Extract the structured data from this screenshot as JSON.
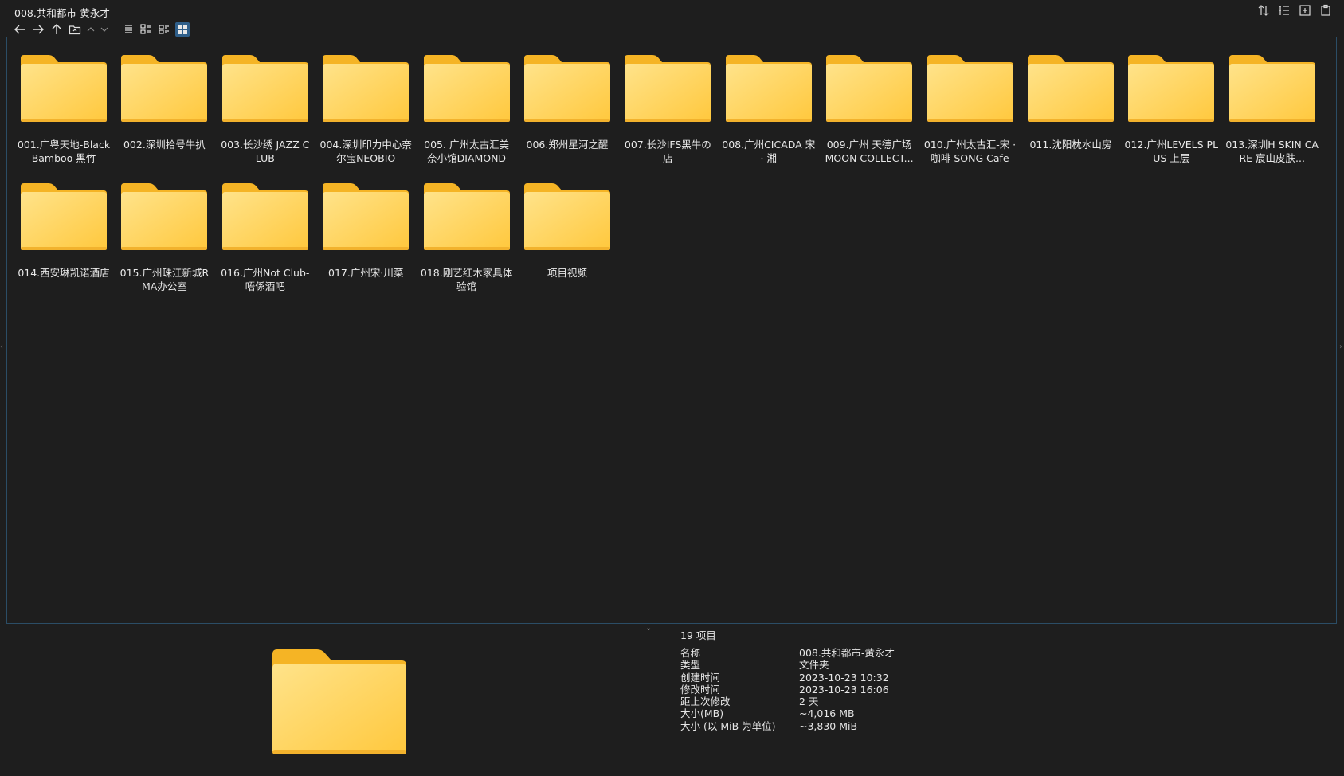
{
  "window": {
    "title": "008.共和都市-黄永才"
  },
  "colors": {
    "background": "#1e1e1e",
    "folder_body": "#ffd25c",
    "folder_tab": "#f5b82e",
    "accent": "#2f5f8a",
    "border": "#2b4d66"
  },
  "toolbar": {
    "icons": [
      "back-arrow-icon",
      "forward-arrow-icon",
      "up-arrow-icon",
      "folder-nav-icon",
      "chevron-up-icon",
      "chevron-down-icon",
      "list-view-icon",
      "details-view-icon",
      "tiles-view-icon",
      "thumbnail-view-icon"
    ],
    "active_view": "thumbnail-view-icon"
  },
  "top_tools": {
    "icons": [
      "sort-icon",
      "tree-list-icon",
      "new-pane-icon",
      "clipboard-icon"
    ]
  },
  "folders": [
    {
      "name": "001.广粤天地-Black Bamboo 黑竹"
    },
    {
      "name": "002.深圳拾号牛扒"
    },
    {
      "name": "003.长沙绣 JAZZ CLUB"
    },
    {
      "name": "004.深圳印力中心奈尔宝NEOBIO"
    },
    {
      "name": "005. 广州太古汇美奈小馆DIAMOND"
    },
    {
      "name": "006.郑州星河之醒"
    },
    {
      "name": "007.长沙IFS黑牛の店"
    },
    {
      "name": "008.广州CICADA 宋 · 湘"
    },
    {
      "name": "009.广州 天德广场 MOON COLLECT..."
    },
    {
      "name": "010.广州太古汇-宋 · 咖啡 SONG Cafe"
    },
    {
      "name": "011.沈阳枕水山房"
    },
    {
      "name": "012.广州LEVELS PLUS 上层"
    },
    {
      "name": "013.深圳H SKIN CARE 宸山皮肤..."
    },
    {
      "name": "014.西安琳凯诺酒店"
    },
    {
      "name": "015.广州珠江新城RMA办公室"
    },
    {
      "name": "016.广州Not Club-唔係酒吧"
    },
    {
      "name": "017.广州宋·川菜"
    },
    {
      "name": "018.刚艺红木家具体验馆"
    },
    {
      "name": "项目视频"
    }
  ],
  "info": {
    "item_count": "19 项目",
    "props": [
      {
        "label": "名称",
        "value": "008.共和都市-黄永才"
      },
      {
        "label": "类型",
        "value": "文件夹"
      },
      {
        "label": "创建时间",
        "value": "2023-10-23  10:32"
      },
      {
        "label": "修改时间",
        "value": "2023-10-23  16:06"
      },
      {
        "label": "距上次修改",
        "value": "2 天"
      },
      {
        "label": "大小(MB)",
        "value": "~4,016 MB"
      },
      {
        "label": "大小 (以 MiB 为单位)",
        "value": "~3,830 MiB"
      }
    ]
  }
}
